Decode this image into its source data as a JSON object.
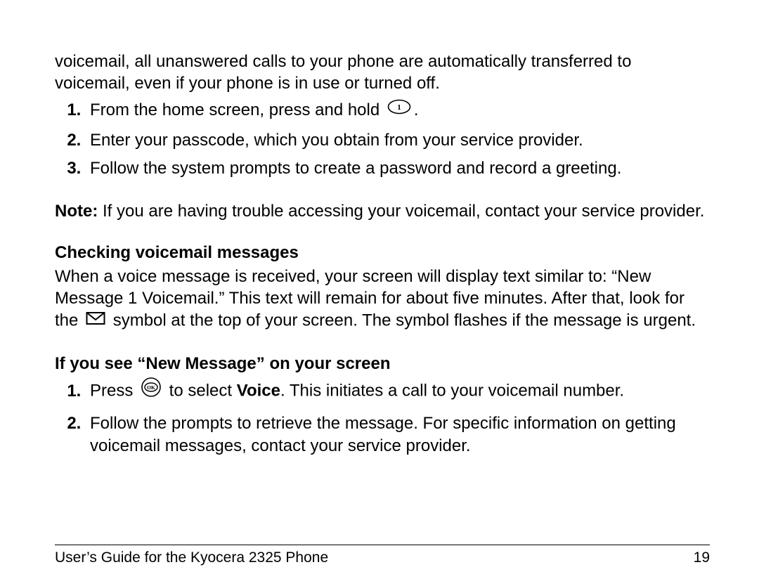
{
  "intro": "voicemail, all unanswered calls to your phone are automatically transferred to voicemail, even if your phone is in use or turned off.",
  "setup_steps": {
    "s1a": "From the home screen, press and hold",
    "s1b": ".",
    "s2": "Enter your passcode, which you obtain from your service provider.",
    "s3": "Follow the system prompts to create a password and record a greeting."
  },
  "note_label": "Note:",
  "note_body": " If you are having trouble accessing your voicemail, contact your service provider.",
  "heading_checking": "Checking voicemail messages",
  "checking_body_a": "When a voice message is received, your screen will display text similar to: “New Message 1 Voicemail.” This text will remain for about five minutes. After that, look for the ",
  "checking_body_b": " symbol at the top of your screen. The symbol flashes if the message is urgent.",
  "heading_newmsg": "If you see “New Message” on your screen",
  "newmsg_steps": {
    "s1a": "Press ",
    "s1b": " to select ",
    "s1c": "Voice",
    "s1d": ". This initiates a call to your voicemail number.",
    "s2": "Follow the prompts to retrieve the message. For specific information on getting voicemail messages, contact your service provider."
  },
  "footer_title": "User’s Guide for the Kyocera 2325 Phone",
  "page_number": "19"
}
